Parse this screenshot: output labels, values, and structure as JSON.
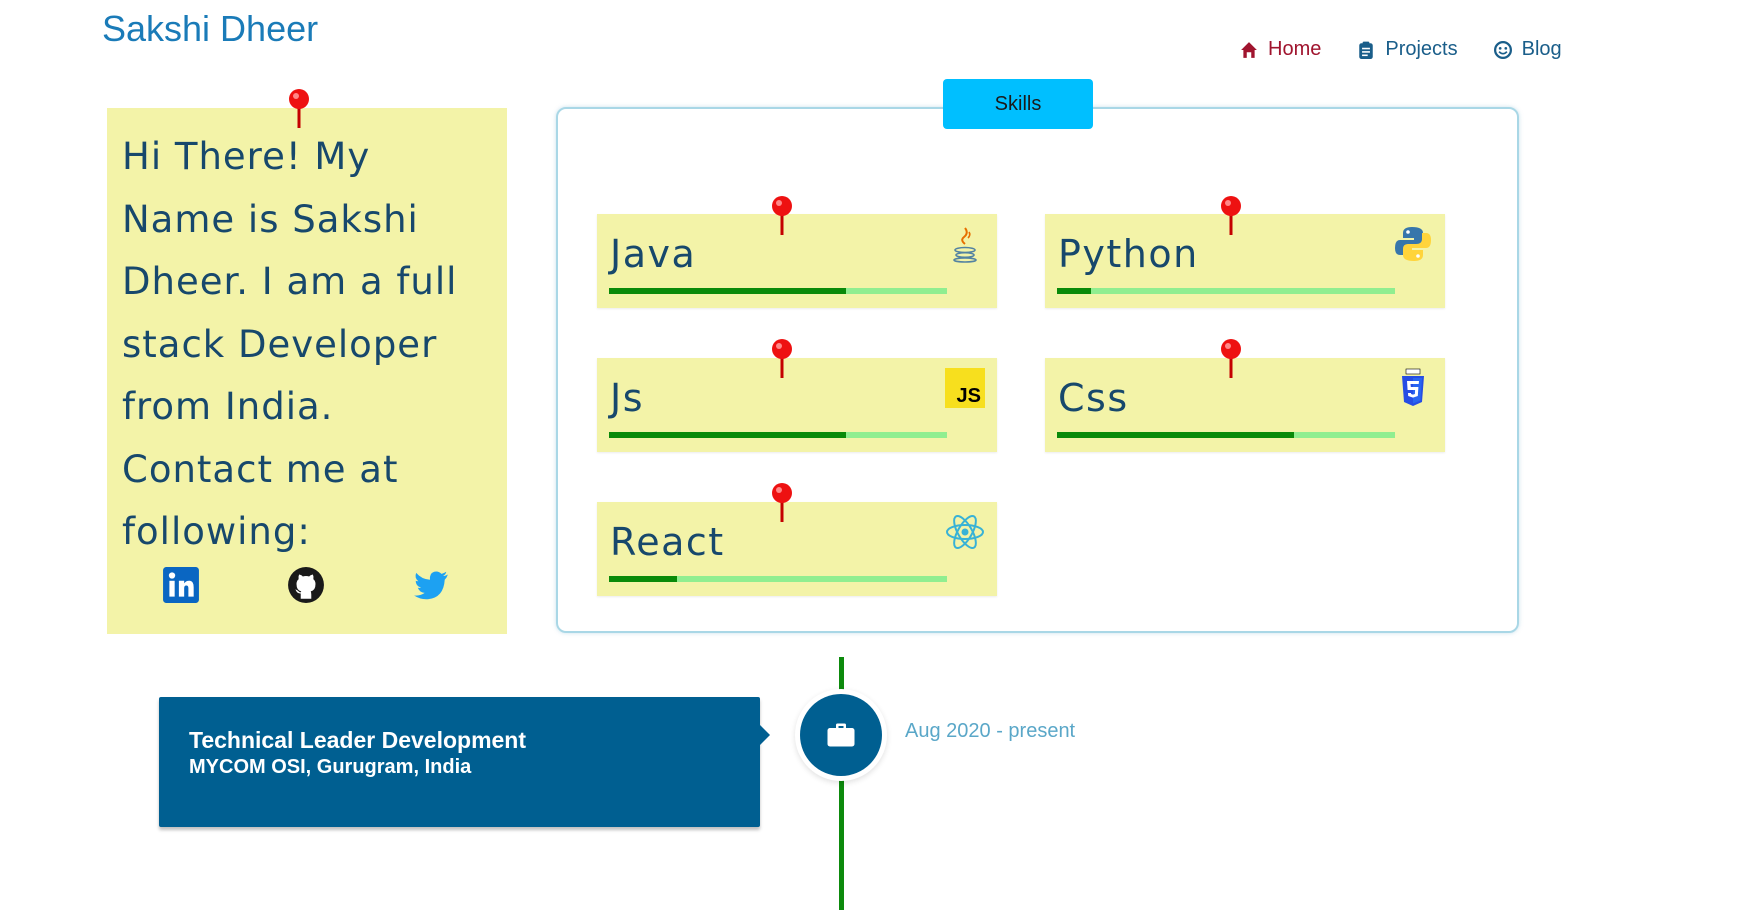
{
  "header": {
    "brand": "Sakshi Dheer",
    "nav": [
      {
        "label": "Home",
        "icon": "home-icon",
        "active": true
      },
      {
        "label": "Projects",
        "icon": "clipboard-icon",
        "active": false
      },
      {
        "label": "Blog",
        "icon": "smile-icon",
        "active": false
      }
    ]
  },
  "intro": {
    "text": "Hi There! My Name is Sakshi Dheer. I am a full stack Developer from India. Contact me at following:",
    "lines": [
      "Hi There! My",
      "Name is Sakshi",
      "Dheer. I am a full",
      "stack Developer",
      "from India.",
      "Contact me at",
      "following:"
    ],
    "socials": [
      "linkedin-icon",
      "github-icon",
      "twitter-icon"
    ]
  },
  "skills": {
    "tab_label": "Skills",
    "items": [
      {
        "name": "Java",
        "level": 0.7,
        "icon": "java-icon"
      },
      {
        "name": "Python",
        "level": 0.1,
        "icon": "python-icon"
      },
      {
        "name": "Js",
        "level": 0.7,
        "icon": "js-icon"
      },
      {
        "name": "Css",
        "level": 0.7,
        "icon": "css3-icon"
      },
      {
        "name": "React",
        "level": 0.2,
        "icon": "react-icon"
      }
    ]
  },
  "timeline": {
    "title": "Technical Leader Development",
    "subtitle": "MYCOM OSI, Gurugram, India",
    "date": "Aug 2020 - present",
    "icon": "briefcase-icon"
  },
  "colors": {
    "brand": "#1a7bb8",
    "nav_active": "#a0142e",
    "note_yellow": "#f3f3a8",
    "skill_fill": "#0a8a0a",
    "skill_track": "#90ee90",
    "tab_blue": "#00bfff",
    "card_blue": "#005f91",
    "timeline_green": "#0d8a0d"
  }
}
